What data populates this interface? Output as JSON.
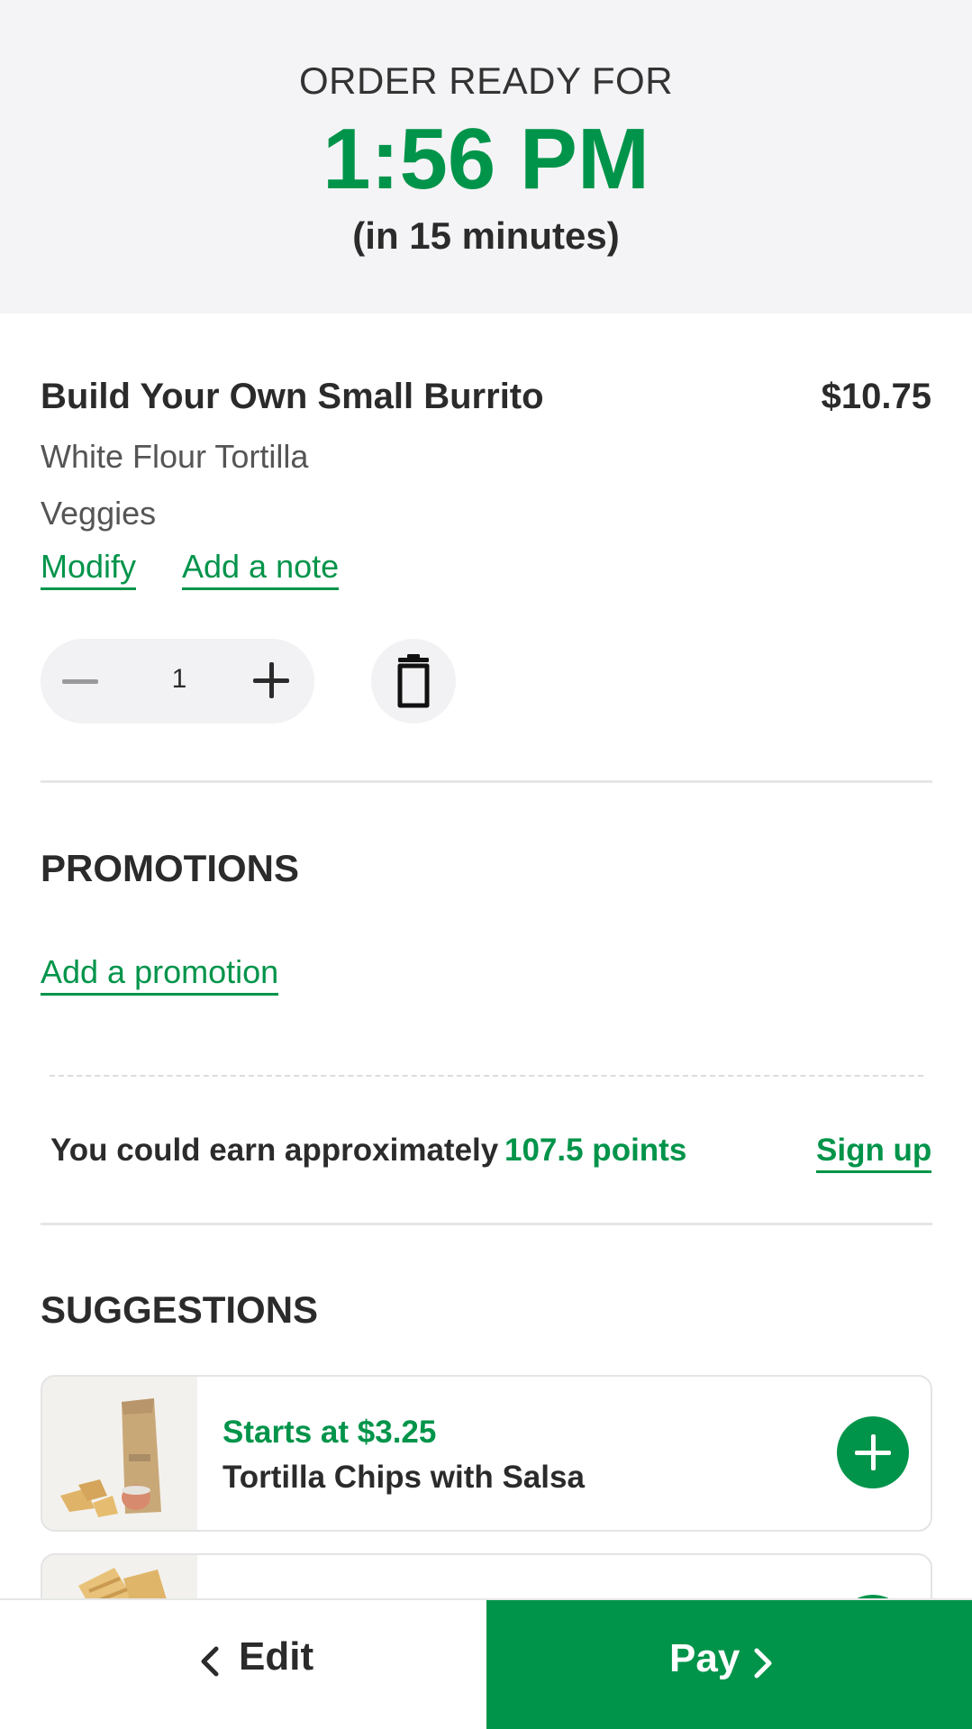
{
  "header": {
    "label": "ORDER READY FOR",
    "time": "1:56 PM",
    "eta": "(in 15 minutes)"
  },
  "item": {
    "name": "Build Your Own Small Burrito",
    "price": "$10.75",
    "options": [
      "White Flour Tortilla",
      "Veggies"
    ],
    "modify_label": "Modify",
    "note_label": "Add a note",
    "quantity": "1",
    "icons": {
      "minus": "minus-icon",
      "plus": "plus-icon",
      "trash": "trash-icon"
    }
  },
  "promotions": {
    "title": "PROMOTIONS",
    "add_label": "Add a promotion"
  },
  "rewards": {
    "text": "You could earn approximately",
    "points": "107.5 points",
    "signup_label": "Sign up"
  },
  "suggestions": {
    "title": "SUGGESTIONS",
    "items": [
      {
        "price": "Starts at $3.25",
        "name": "Tortilla Chips with Salsa",
        "image": "chips-salsa-bag-image"
      },
      {
        "price": "",
        "name": "",
        "image": "quesadilla-image"
      }
    ]
  },
  "footer": {
    "edit_label": "Edit",
    "pay_label": "Pay"
  },
  "colors": {
    "brand_green": "#00944a",
    "header_bg": "#f4f4f6",
    "text_dark": "#2b2b2b"
  }
}
